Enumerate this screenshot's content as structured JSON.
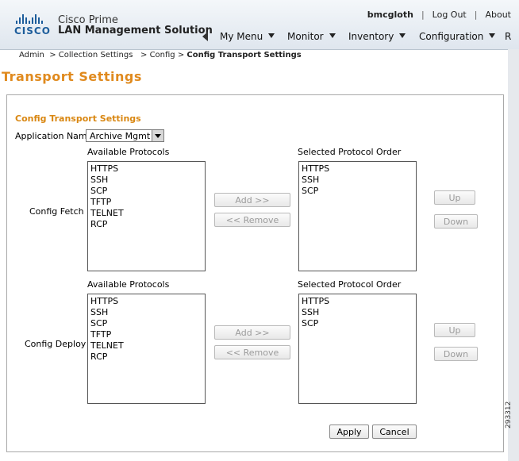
{
  "header": {
    "brand_word": "CISCO",
    "product_line1": "Cisco Prime",
    "product_line2": "LAN Management Solution",
    "user": "bmcgloth",
    "logout": "Log Out",
    "about": "About",
    "nav": [
      "My Menu",
      "Monitor",
      "Inventory",
      "Configuration",
      "R"
    ]
  },
  "breadcrumb": [
    "Admin",
    "Collection Settings",
    "Config",
    "Config Transport Settings"
  ],
  "page_title": "Transport Settings",
  "panel": {
    "title": "Config Transport Settings",
    "app_name_label": "Application Name:",
    "app_name_value": "Archive Mgmt"
  },
  "fetch": {
    "label": "Config Fetch :",
    "available_header": "Available Protocols",
    "selected_header": "Selected Protocol Order",
    "available": [
      "HTTPS",
      "SSH",
      "SCP",
      "TFTP",
      "TELNET",
      "RCP"
    ],
    "selected": [
      "HTTPS",
      "SSH",
      "SCP"
    ]
  },
  "deploy": {
    "label": "Config Deploy :",
    "available_header": "Available Protocols",
    "selected_header": "Selected Protocol Order",
    "available": [
      "HTTPS",
      "SSH",
      "SCP",
      "TFTP",
      "TELNET",
      "RCP"
    ],
    "selected": [
      "HTTPS",
      "SSH",
      "SCP"
    ]
  },
  "buttons": {
    "add": "Add   >>",
    "remove": "<<  Remove",
    "up": "Up",
    "down": "Down",
    "apply": "Apply",
    "cancel": "Cancel"
  },
  "figure_id": "293312"
}
